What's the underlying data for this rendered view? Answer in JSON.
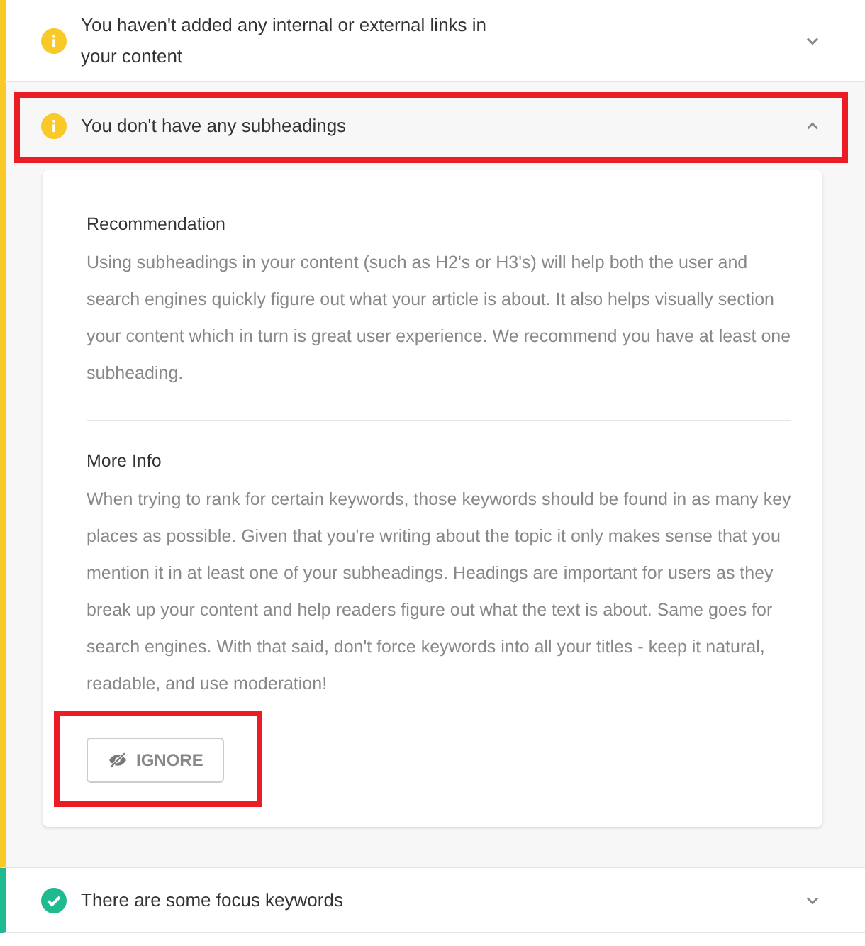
{
  "checks": [
    {
      "kind": "warning",
      "title": "You haven't added any internal or external links in your content",
      "expanded": false,
      "highlighted": false
    },
    {
      "kind": "warning",
      "title": "You don't have any subheadings",
      "expanded": true,
      "highlighted": true,
      "details": {
        "sections": [
          {
            "heading": "Recommendation",
            "text": "Using subheadings in your content (such as H2's or H3's) will help both the user and search engines quickly figure out what your article is about. It also helps visually section your content which in turn is great user experience. We recommend you have at least one subheading."
          },
          {
            "heading": "More Info",
            "text": "When trying to rank for certain keywords, those keywords should be found in as many key places as possible. Given that you're writing about the topic it only makes sense that you mention it in at least one of your subheadings. Headings are important for users as they break up your content and help readers figure out what the text is about. Same goes for search engines. With that said, don't force keywords into all your titles - keep it natural, readable, and use moderation!"
          }
        ],
        "ignore_button": {
          "label": "IGNORE",
          "highlighted": true
        }
      }
    },
    {
      "kind": "success",
      "title": "There are some focus keywords",
      "expanded": false,
      "highlighted": false
    }
  ]
}
